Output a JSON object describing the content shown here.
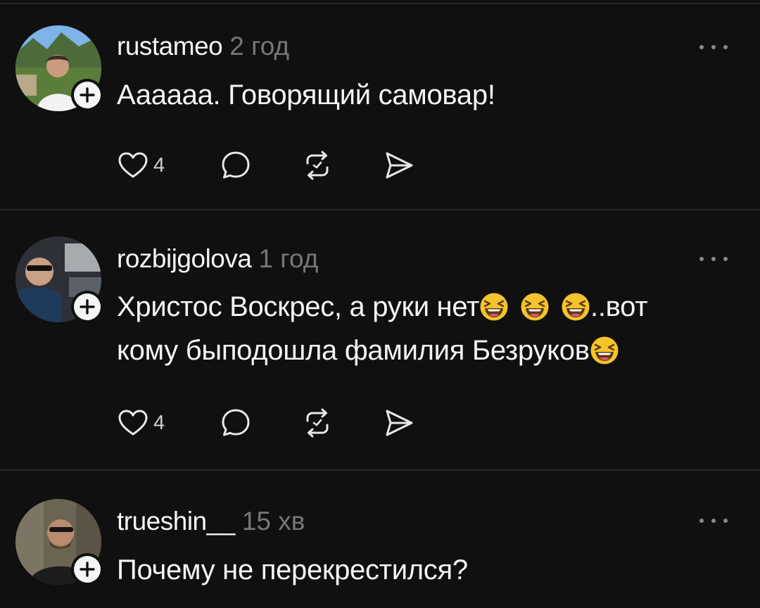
{
  "posts": [
    {
      "username": "rustameo",
      "time": "2 год",
      "text": "Аааааа. Говорящий самовар!",
      "likes": "4"
    },
    {
      "username": "rozbijgolova",
      "time": "1 год",
      "text_line1": "Христос Воскрес, а руки нет",
      "text_line1_tail": "..вот",
      "text_line2": "кому быподошла фамилия Безруков",
      "likes": "4"
    },
    {
      "username": "trueshin__",
      "time": "15 хв",
      "text": "Почему не перекрестился?"
    }
  ],
  "icons": {
    "like": "heart-icon",
    "reply": "comment-icon",
    "repost": "repost-icon",
    "share": "send-icon",
    "more": "more-dots-icon",
    "follow": "plus-icon",
    "emoji": "laughing-face-emoji"
  },
  "colors": {
    "background": "#101010",
    "text": "#f3f5f7",
    "muted": "#777777",
    "emoji": "#f5c32c"
  }
}
